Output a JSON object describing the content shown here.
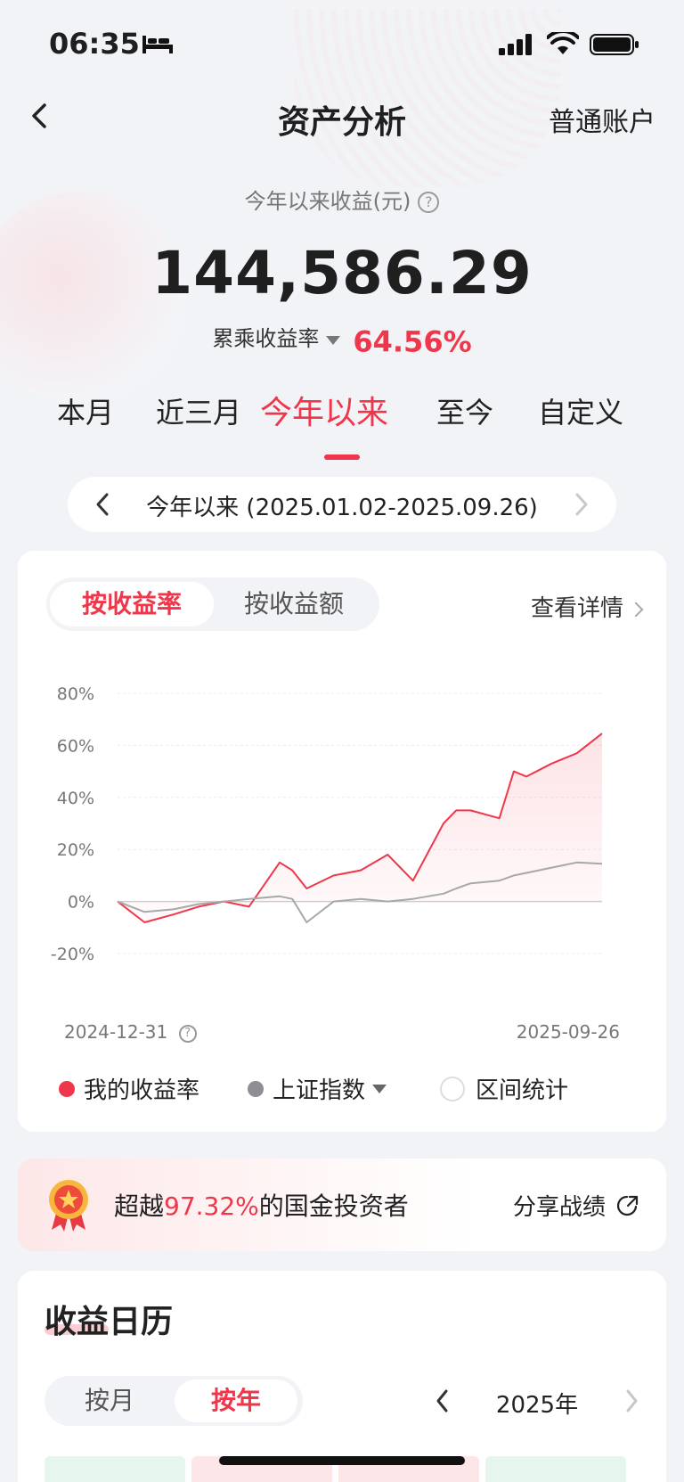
{
  "status_bar": {
    "time": "06:35"
  },
  "nav": {
    "title": "资产分析",
    "right": "普通账户"
  },
  "summary": {
    "label": "今年以来收益(元)",
    "help": "?",
    "amount": "144,586.29",
    "rate_label": "累乘收益率",
    "rate_value": "64.56%"
  },
  "period_tabs": [
    "本月",
    "近三月",
    "今年以来",
    "至今",
    "自定义"
  ],
  "active_period": "今年以来",
  "range": {
    "text": "今年以来 (2025.01.02-2025.09.26)"
  },
  "chart_card": {
    "toggle": [
      "按收益率",
      "按收益额"
    ],
    "detail": "查看详情",
    "date_start": "2024-12-31",
    "date_end": "2025-09-26",
    "legend": {
      "mine": "我的收益率",
      "index": "上证指数",
      "stats": "区间统计"
    }
  },
  "chart_data": {
    "type": "line",
    "ylim": [
      -20,
      80
    ],
    "yticks": [
      "80%",
      "60%",
      "40%",
      "20%",
      "0%",
      "-20%"
    ],
    "x": [
      "2024-12-31",
      "2025-01-15",
      "2025-01-31",
      "2025-02-14",
      "2025-02-28",
      "2025-03-14",
      "2025-03-31",
      "2025-04-07",
      "2025-04-15",
      "2025-04-30",
      "2025-05-15",
      "2025-05-30",
      "2025-06-13",
      "2025-06-30",
      "2025-07-07",
      "2025-07-15",
      "2025-07-31",
      "2025-08-08",
      "2025-08-15",
      "2025-08-29",
      "2025-09-12",
      "2025-09-26"
    ],
    "series": [
      {
        "name": "我的收益率",
        "color": "#f0364a",
        "fill": true,
        "values": [
          0,
          -8,
          -5,
          -2,
          0,
          -2,
          15,
          12,
          5,
          10,
          12,
          18,
          8,
          30,
          35,
          35,
          32,
          50,
          48,
          53,
          57,
          64.56
        ]
      },
      {
        "name": "上证指数",
        "color": "#a8a8a8",
        "fill": false,
        "values": [
          0,
          -4,
          -3,
          -1,
          0,
          1,
          2,
          1,
          -8,
          0,
          1,
          0,
          1,
          3,
          5,
          7,
          8,
          10,
          11,
          13,
          15,
          14.5
        ]
      }
    ]
  },
  "beat": {
    "prefix": "超越",
    "percent": "97.32%",
    "suffix": "的国金投资者",
    "share": "分享战绩"
  },
  "calendar": {
    "title": "收益日历",
    "toggle": [
      "按月",
      "按年"
    ],
    "year": "2025年"
  },
  "colors": {
    "accent": "#f0364a",
    "index": "#8e8e93",
    "bg": "#f2f3f7"
  }
}
